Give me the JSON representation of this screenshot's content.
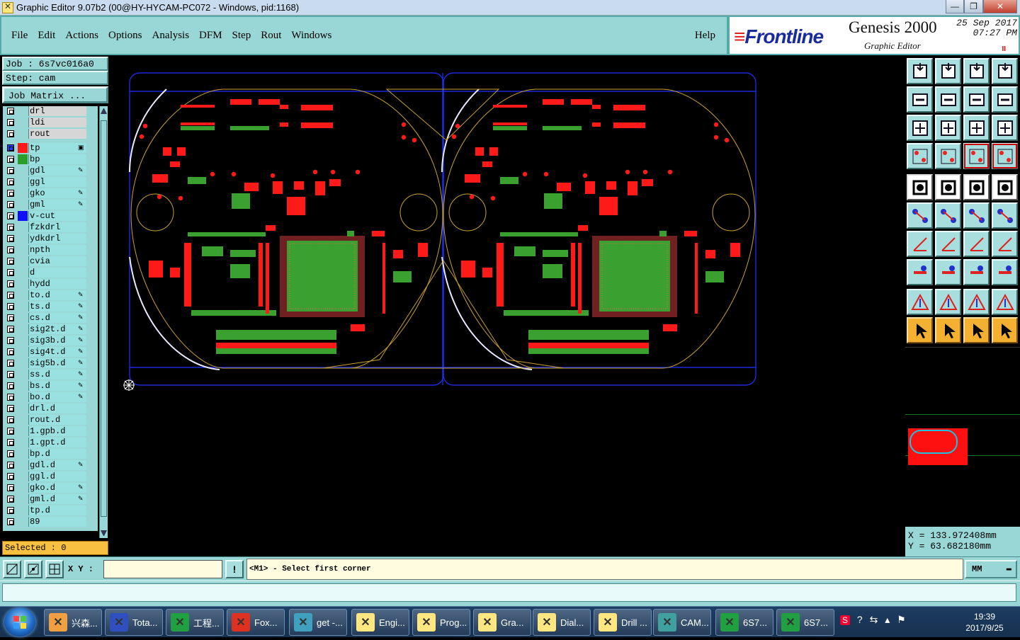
{
  "window": {
    "title": "Graphic Editor 9.07b2 (00@HY-HYCAM-PC072 - Windows, pid:1168)",
    "minimize": "—",
    "restore": "❐",
    "close": "✕"
  },
  "menu": [
    "File",
    "Edit",
    "Actions",
    "Options",
    "Analysis",
    "DFM",
    "Step",
    "Rout",
    "Windows"
  ],
  "help": "Help",
  "brand": {
    "logo": "Frontline",
    "product": "Genesis 2000",
    "subtitle": "Graphic Editor",
    "date_line1": "25 Sep 2017",
    "date_line2": "07:27 PM",
    "pause": "II"
  },
  "job": {
    "label": "Job : 6s7vc016a0",
    "step": "Step: cam",
    "matrix_button": "Job Matrix ..."
  },
  "layers_top": [
    {
      "name": "drl",
      "color": "",
      "gray": true
    },
    {
      "name": "ldi",
      "color": "",
      "gray": true
    },
    {
      "name": "rout",
      "color": "",
      "gray": true
    }
  ],
  "layers": [
    {
      "name": "tp",
      "color": "#ff1a1a",
      "flag": "▣",
      "active": true
    },
    {
      "name": "bp",
      "color": "#2aa02a",
      "flag": ""
    },
    {
      "name": "gdl",
      "color": "",
      "flag": "✎"
    },
    {
      "name": "ggl",
      "color": "",
      "flag": ""
    },
    {
      "name": "gko",
      "color": "",
      "flag": "✎"
    },
    {
      "name": "gml",
      "color": "",
      "flag": "✎"
    },
    {
      "name": "v-cut",
      "color": "#1010ff",
      "flag": ""
    },
    {
      "name": "fzkdrl",
      "color": "",
      "flag": ""
    },
    {
      "name": "ydkdrl",
      "color": "",
      "flag": ""
    },
    {
      "name": "npth",
      "color": "",
      "flag": ""
    },
    {
      "name": "cvia",
      "color": "",
      "flag": ""
    },
    {
      "name": "d",
      "color": "",
      "flag": ""
    },
    {
      "name": "hydd",
      "color": "",
      "flag": ""
    },
    {
      "name": "to.d",
      "color": "",
      "flag": "✎"
    },
    {
      "name": "ts.d",
      "color": "",
      "flag": "✎"
    },
    {
      "name": "cs.d",
      "color": "",
      "flag": "✎"
    },
    {
      "name": "sig2t.d",
      "color": "",
      "flag": "✎"
    },
    {
      "name": "sig3b.d",
      "color": "",
      "flag": "✎"
    },
    {
      "name": "sig4t.d",
      "color": "",
      "flag": "✎"
    },
    {
      "name": "sig5b.d",
      "color": "",
      "flag": "✎"
    },
    {
      "name": "ss.d",
      "color": "",
      "flag": "✎"
    },
    {
      "name": "bs.d",
      "color": "",
      "flag": "✎"
    },
    {
      "name": "bo.d",
      "color": "",
      "flag": "✎"
    },
    {
      "name": "drl.d",
      "color": "",
      "flag": ""
    },
    {
      "name": "rout.d",
      "color": "",
      "flag": ""
    },
    {
      "name": "1.gpb.d",
      "color": "",
      "flag": ""
    },
    {
      "name": "1.gpt.d",
      "color": "",
      "flag": ""
    },
    {
      "name": "bp.d",
      "color": "",
      "flag": ""
    },
    {
      "name": "gdl.d",
      "color": "",
      "flag": "✎"
    },
    {
      "name": "ggl.d",
      "color": "",
      "flag": ""
    },
    {
      "name": "gko.d",
      "color": "",
      "flag": "✎"
    },
    {
      "name": "gml.d",
      "color": "",
      "flag": "✎"
    },
    {
      "name": "tp.d",
      "color": "",
      "flag": ""
    },
    {
      "name": "89",
      "color": "",
      "flag": ""
    }
  ],
  "selected": "Selected : 0",
  "coords": {
    "x": "X = 133.972408mm",
    "y": "Y = 63.682180mm"
  },
  "xy_label": "X Y :",
  "xy_value": "",
  "prompt": "<M1> - Select first corner",
  "units": "MM",
  "taskbar": {
    "items": [
      {
        "label": "兴森...",
        "color": "#f0a040"
      },
      {
        "label": "Tota...",
        "color": "#3050c0"
      },
      {
        "label": "工程...",
        "color": "#20a040"
      },
      {
        "label": "Fox...",
        "color": "#e03020"
      },
      {
        "label": "get -...",
        "color": "#40a0c0"
      },
      {
        "label": "Engi...",
        "color": "#ffe680"
      },
      {
        "label": "Prog...",
        "color": "#ffe680"
      },
      {
        "label": "Gra...",
        "color": "#ffe680"
      },
      {
        "label": "Dial...",
        "color": "#ffe680"
      },
      {
        "label": "Drill ...",
        "color": "#ffe680"
      },
      {
        "label": "CAM...",
        "color": "#40a0a0"
      },
      {
        "label": "6S7...",
        "color": "#20a040"
      },
      {
        "label": "6S7...",
        "color": "#20a040"
      }
    ],
    "time": "19:39",
    "date": "2017/9/25"
  },
  "colors": {
    "panel": "#99d6d6",
    "layer_top": "#ff1a1a",
    "layer_bottom": "#2aa02a",
    "outline": "#2030ff",
    "rout": "#c8a030"
  }
}
